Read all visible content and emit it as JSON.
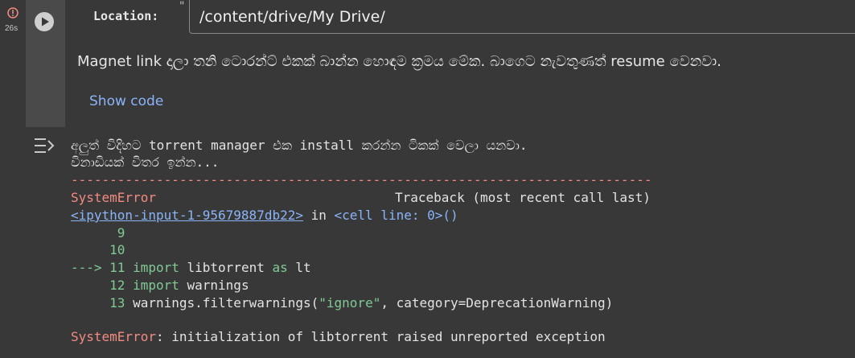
{
  "cell": {
    "exec_time": "26s",
    "location_label": "Location:",
    "location_quote": "\"",
    "location_value": "/content/drive/My Drive/",
    "description": "Magnet link දාලා තනි ටොරන්ට් එකක් බාන්න හොඳම ක්‍රමය මේක. බාගෙට නැවතුණත් resume වෙනවා.",
    "show_code": "Show code"
  },
  "output": {
    "line1": "අලුත් විදිහට torrent manager එක install කරන්න ටිකක් වෙලා යනවා.",
    "line2": "විනාඩියක් විතර ඉන්න...",
    "separator": "---------------------------------------------------------------------------",
    "error_name": "SystemError",
    "traceback_label": "Traceback (most recent call last)",
    "input_link": "<ipython-input-1-95679887db22>",
    "in_word": " in ",
    "cell_line": "<cell line: 0>()",
    "code_lines": [
      {
        "marker": "      ",
        "num": "9",
        "code": ""
      },
      {
        "marker": "     ",
        "num": "10",
        "code": ""
      },
      {
        "marker": "---> ",
        "num": "11",
        "kw": "import",
        "rest": " libtorrent ",
        "kw2": "as",
        "rest2": " lt"
      },
      {
        "marker": "     ",
        "num": "12",
        "kw": "import",
        "rest": " warnings"
      },
      {
        "marker": "     ",
        "num": "13",
        "pre": " warnings.filterwarnings(",
        "str": "\"ignore\"",
        "post": ", category=DeprecationWarning)"
      }
    ],
    "final_error_name": "SystemError",
    "final_error_msg": ": initialization of libtorrent raised unreported exception"
  }
}
